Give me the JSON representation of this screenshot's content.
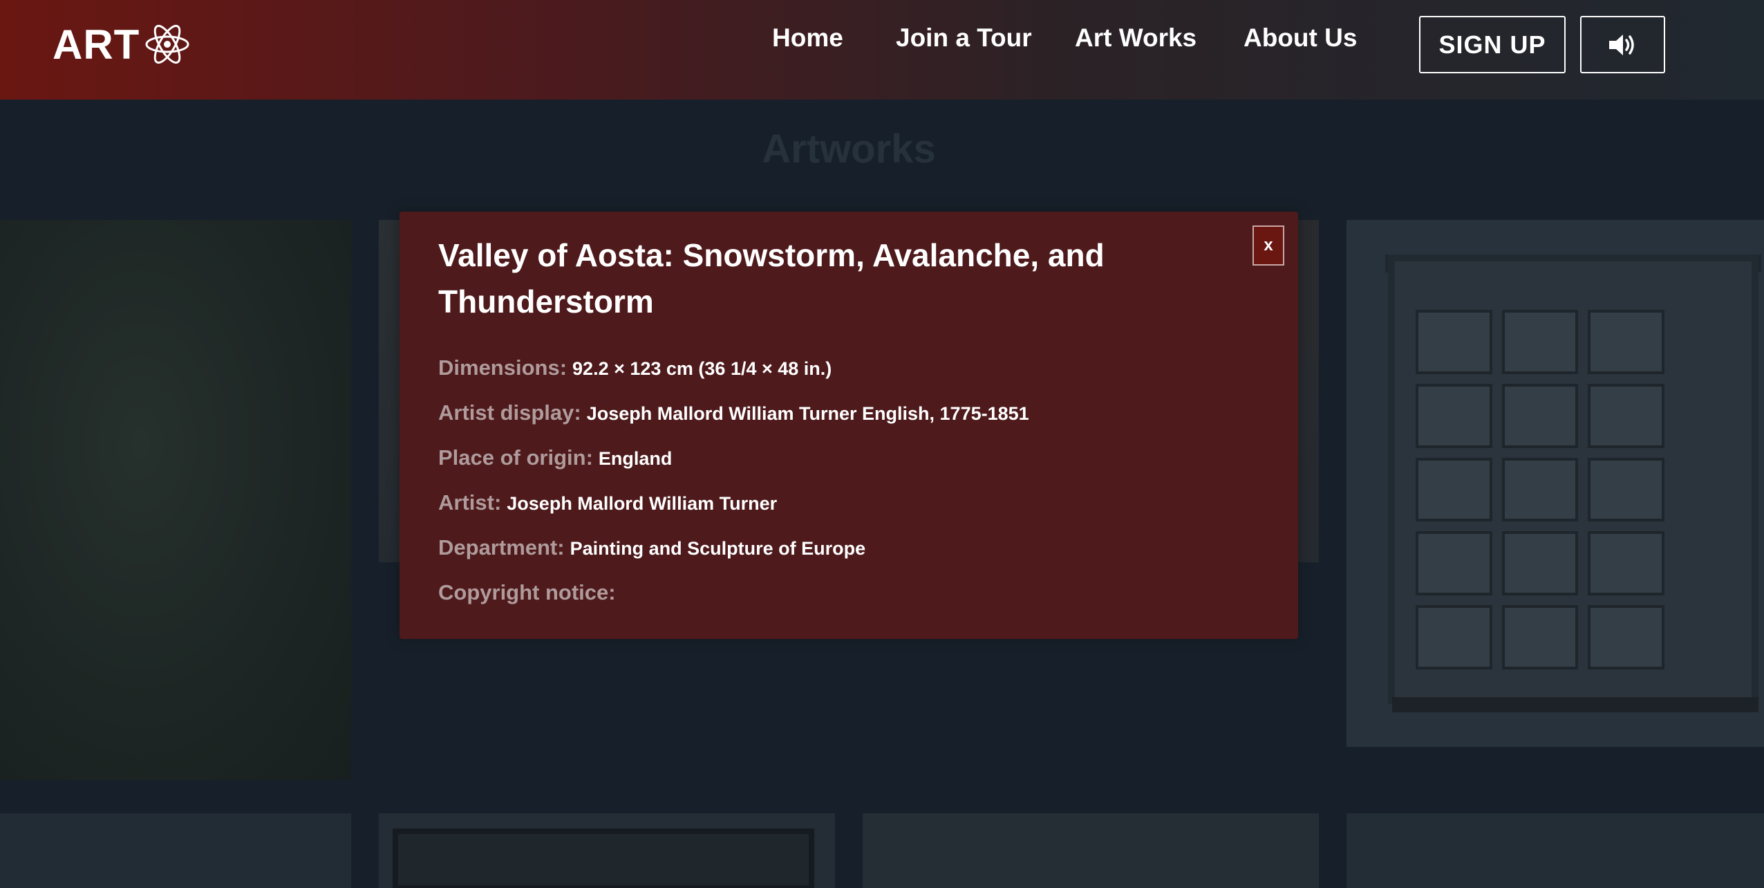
{
  "header": {
    "logo_text": "ART",
    "logo_icon": "atom-icon",
    "nav": [
      {
        "label": "Home"
      },
      {
        "label": "Join a Tour"
      },
      {
        "label": "Art Works"
      },
      {
        "label": "About Us"
      }
    ],
    "signup_label": "SIGN UP",
    "sound_icon": "speaker-volume-icon"
  },
  "main": {
    "title": "Artworks"
  },
  "modal": {
    "title": "Valley of Aosta: Snowstorm, Avalanche, and Thunderstorm",
    "close_label": "x",
    "fields": [
      {
        "label": "Dimensions:",
        "value": "92.2 × 123 cm (36 1/4 × 48 in.)"
      },
      {
        "label": "Artist display:",
        "value": "Joseph Mallord William Turner English, 1775-1851"
      },
      {
        "label": "Place of origin:",
        "value": "England"
      },
      {
        "label": "Artist:",
        "value": "Joseph Mallord William Turner"
      },
      {
        "label": "Department:",
        "value": "Painting and Sculpture of Europe"
      },
      {
        "label": "Copyright notice:",
        "value": ""
      }
    ]
  },
  "colors": {
    "header_gradient_start": "#6a1712",
    "header_gradient_end": "#202830",
    "page_background": "#17202a",
    "modal_background": "#4e1a1c",
    "label_color": "#b09b9c"
  }
}
